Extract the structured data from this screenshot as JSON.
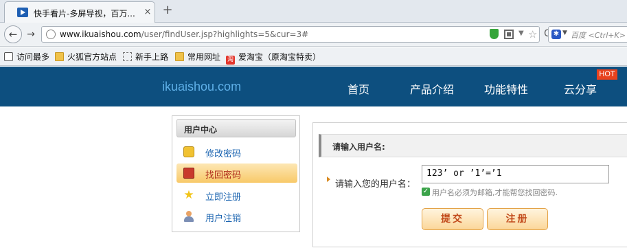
{
  "browser": {
    "tab": {
      "title": "快手看片-多屏导视，百万...",
      "close": "×"
    },
    "new_tab": "+",
    "nav": {
      "back": "←",
      "forward": "→",
      "reload": "C"
    },
    "url": {
      "host": "www.ikuaishou.com",
      "path": "/user/findUser.jsp?highlights=5&cur=3#"
    },
    "search_placeholder": "百度 <Ctrl+K>",
    "bookmarks": [
      {
        "label": "访问最多",
        "icon": "most-visited-icon"
      },
      {
        "label": "火狐官方站点",
        "icon": "folder-icon"
      },
      {
        "label": "新手上路",
        "icon": "dashed-folder-icon"
      },
      {
        "label": "常用网址",
        "icon": "folder-icon"
      },
      {
        "label": "爱淘宝（原淘宝特卖）",
        "icon": "taobao-icon",
        "icon_text": "淘"
      }
    ]
  },
  "site": {
    "logo": "ikuaishou.com",
    "nav": [
      "首页",
      "产品介绍",
      "功能特性",
      "云分享"
    ],
    "hot_badge": "HOT",
    "colors": {
      "header": "#0d4f7f",
      "logo": "#5fb0e8",
      "badge": "#e8421e"
    }
  },
  "sidebar": {
    "title": "用户中心",
    "items": [
      {
        "label": "修改密码",
        "icon": "key-icon",
        "active": false
      },
      {
        "label": "找回密码",
        "icon": "toolbox-icon",
        "active": true
      },
      {
        "label": "立即注册",
        "icon": "star-icon",
        "active": false
      },
      {
        "label": "用户注销",
        "icon": "user-icon",
        "active": false
      }
    ]
  },
  "form": {
    "title": "请输入用户名:",
    "label": "请输入您的用户名：",
    "username_value": "123’ or ’1’=’1",
    "hint": "用户名必须为邮箱,才能帮您找回密码.",
    "submit_label": "提交",
    "register_label": "注册"
  }
}
